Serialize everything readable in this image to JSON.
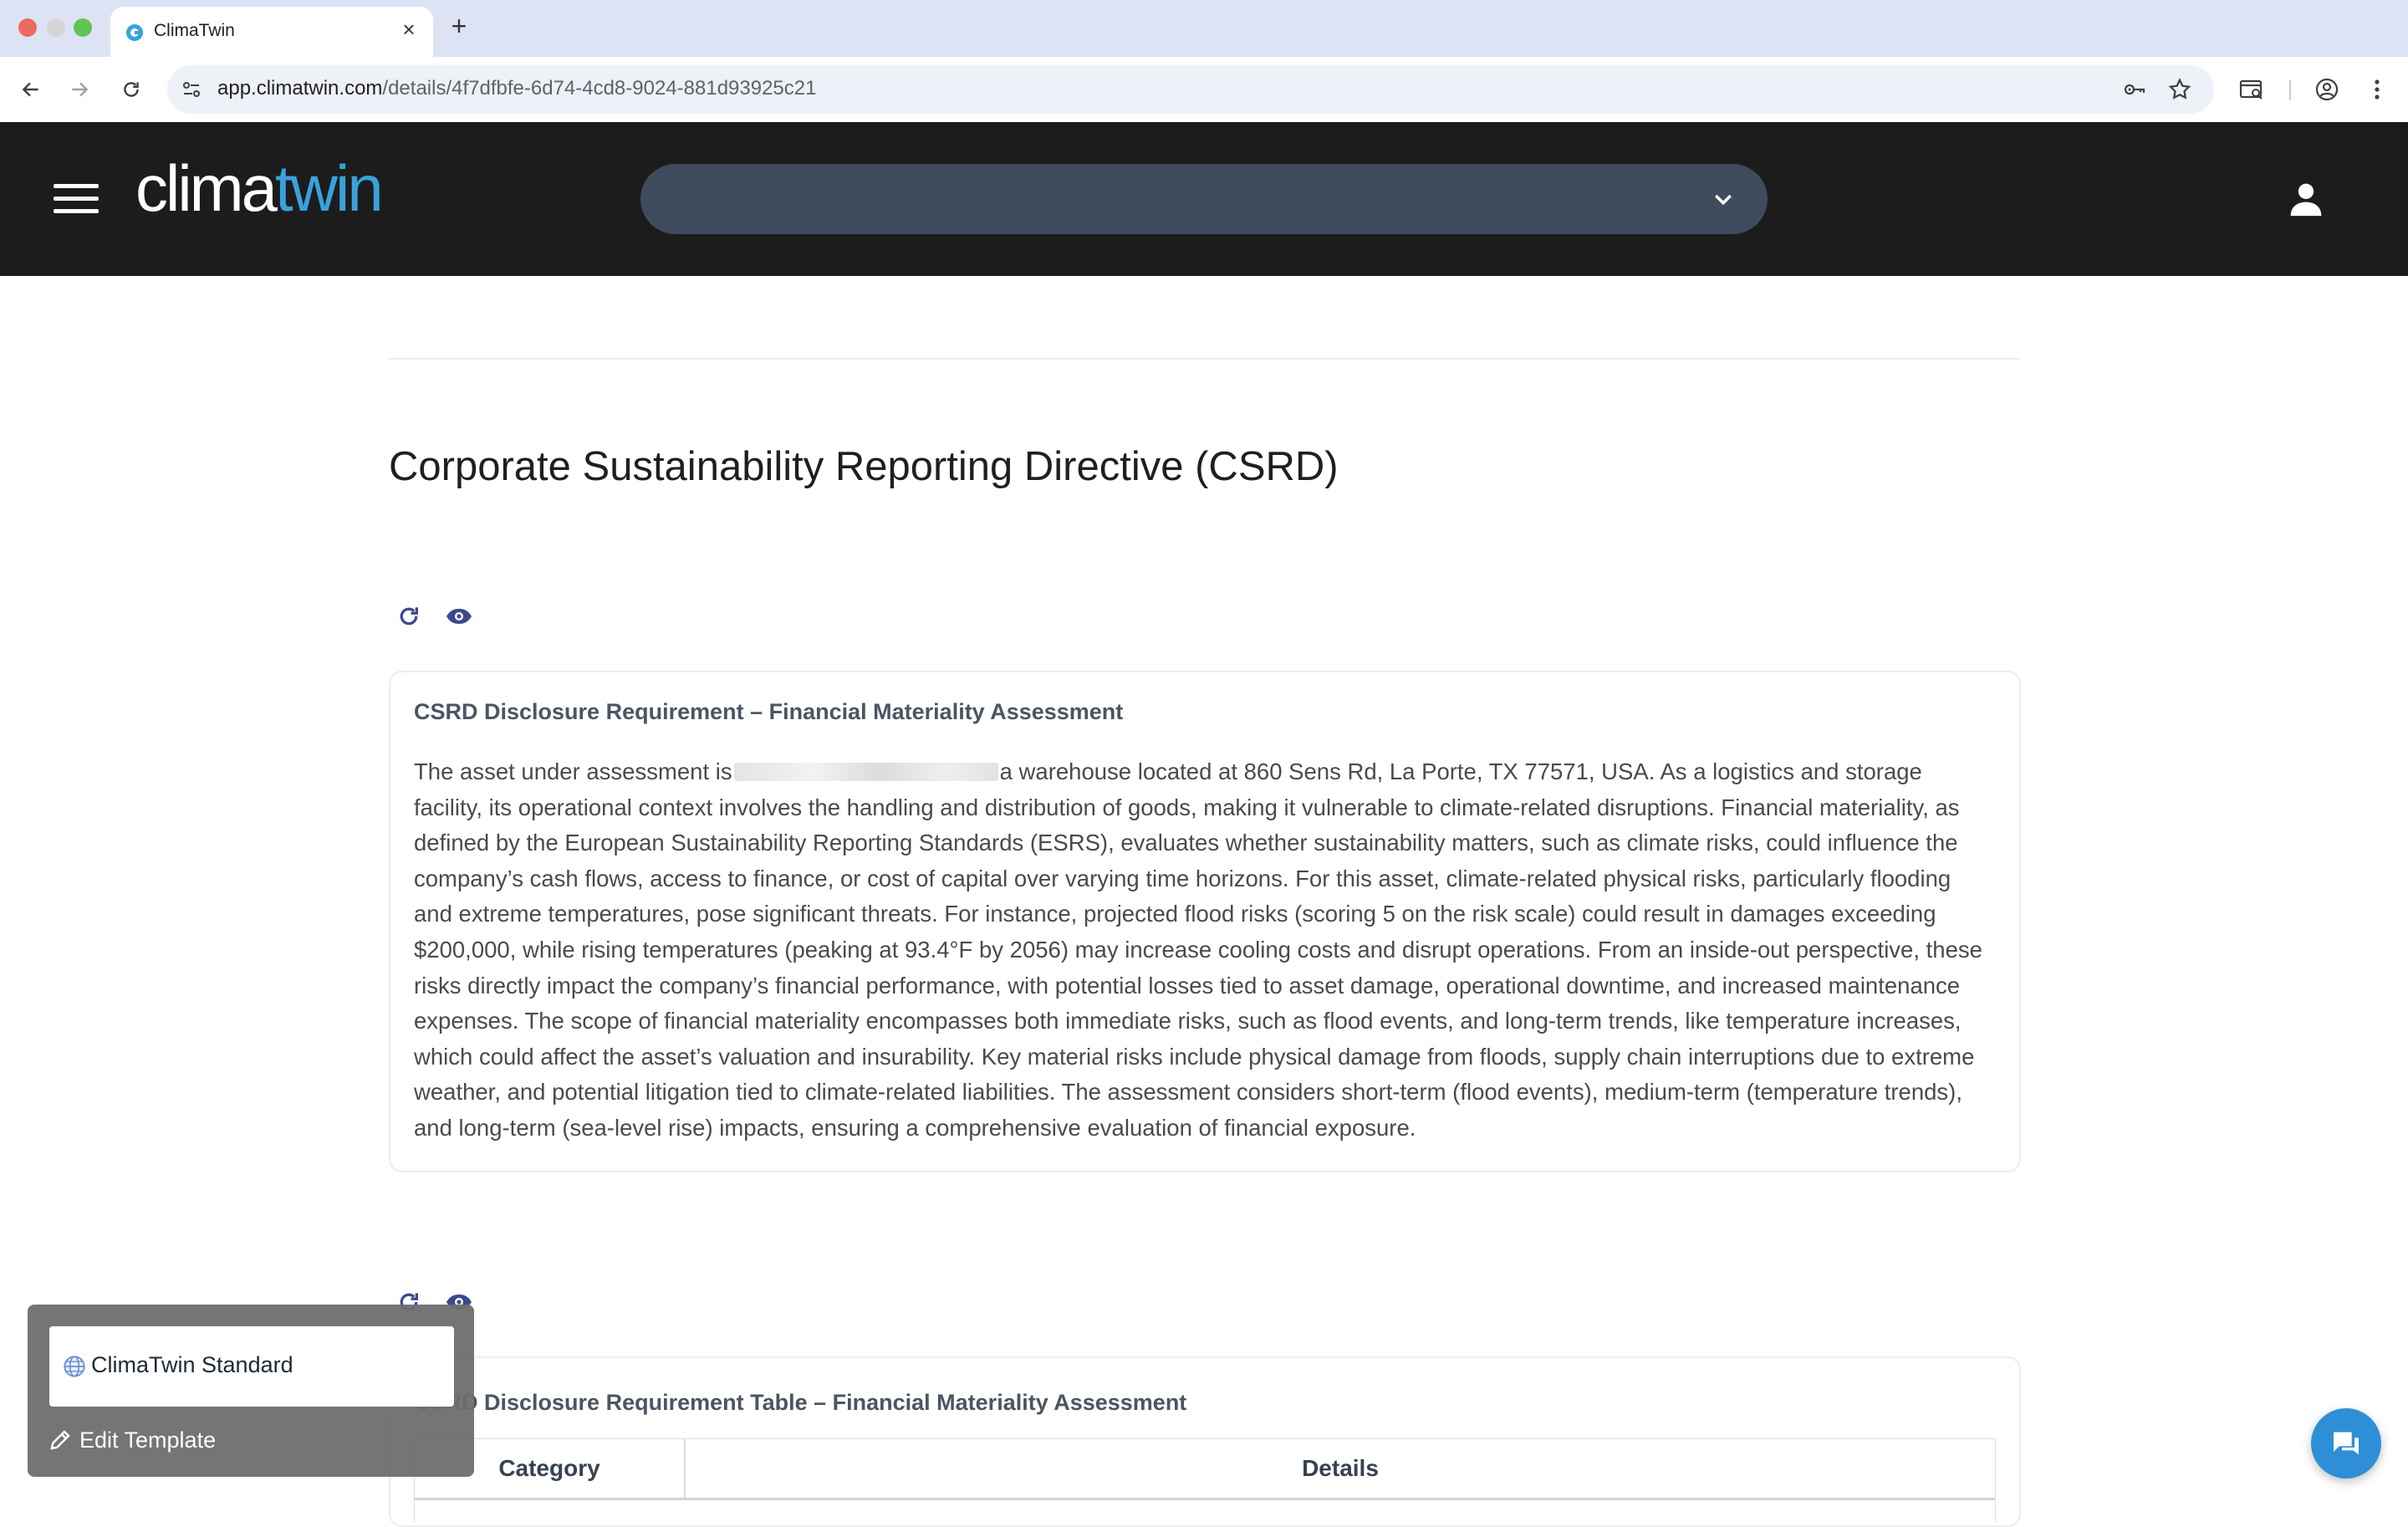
{
  "browser": {
    "tab_title": "ClimaTwin",
    "url_host": "app.climatwin.com",
    "url_path": "/details/4f7dfbfe-6d74-4cd8-9024-881d93925c21"
  },
  "header": {
    "logo_part1": "clima",
    "logo_part2": "twin",
    "asset_select_value": ""
  },
  "page": {
    "title": "Corporate Sustainability Reporting Directive (CSRD)"
  },
  "sections": [
    {
      "title": "CSRD Disclosure Requirement – Financial Materiality Assessment",
      "body_before": "The asset under assessment is",
      "body_after": "a warehouse located at 860 Sens Rd, La Porte, TX 77571, USA. As a logistics and storage facility, its operational context involves the handling and distribution of goods, making it vulnerable to climate-related disruptions. Financial materiality, as defined by the European Sustainability Reporting Standards (ESRS), evaluates whether sustainability matters, such as climate risks, could influence the company’s cash flows, access to finance, or cost of capital over varying time horizons. For this asset, climate-related physical risks, particularly flooding and extreme temperatures, pose significant threats. For instance, projected flood risks (scoring 5 on the risk scale) could result in damages exceeding $200,000, while rising temperatures (peaking at 93.4°F by 2056) may increase cooling costs and disrupt operations. From an inside-out perspective, these risks directly impact the company’s financial performance, with potential losses tied to asset damage, operational downtime, and increased maintenance expenses. The scope of financial materiality encompasses both immediate risks, such as flood events, and long-term trends, like temperature increases, which could affect the asset’s valuation and insurability. Key material risks include physical damage from floods, supply chain interruptions due to extreme weather, and potential litigation tied to climate-related liabilities. The assessment considers short-term (flood events), medium-term (temperature trends), and long-term (sea-level rise) impacts, ensuring a comprehensive evaluation of financial exposure."
    },
    {
      "title": "CSRD Disclosure Requirement Table – Financial Materiality Assessment",
      "columns": [
        "Category",
        "Details"
      ]
    }
  ],
  "popup": {
    "option_label": "ClimaTwin Standard",
    "edit_label": "Edit Template"
  },
  "icons": {
    "refresh": "refresh-icon",
    "view": "eye-icon",
    "chat": "chat-icon",
    "user": "user-icon"
  },
  "colors": {
    "header_bg": "#1c1c1c",
    "logo_accent": "#3aa1dc",
    "select_bg": "#404b5e",
    "icon_blue": "#3b4a8c",
    "chat_fab": "#2f8fd6"
  }
}
